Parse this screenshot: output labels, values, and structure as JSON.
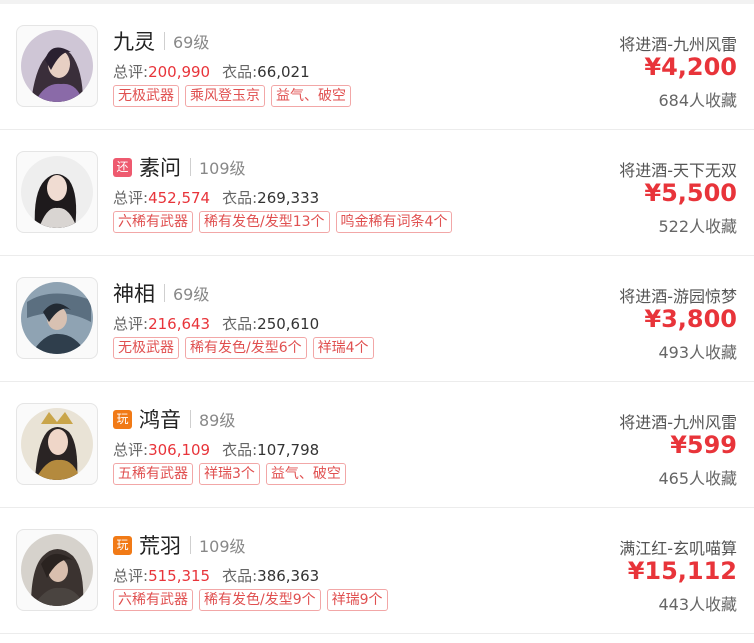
{
  "listings": [
    {
      "tag": "",
      "name": "九灵",
      "level": "69级",
      "score_label": "总评:",
      "score": "200,990",
      "outfit_label": "衣品:",
      "outfit": "66,021",
      "chips": [
        "无极武器",
        "乘风登玉京",
        "益气、破空"
      ],
      "server": "将进酒-九州风雷",
      "price": "¥4,200",
      "favorites": "684人收藏"
    },
    {
      "tag": "还",
      "name": "素问",
      "level": "109级",
      "score_label": "总评:",
      "score": "452,574",
      "outfit_label": "衣品:",
      "outfit": "269,333",
      "chips": [
        "六稀有武器",
        "稀有发色/发型13个",
        "鸣金稀有词条4个"
      ],
      "server": "将进酒-天下无双",
      "price": "¥5,500",
      "favorites": "522人收藏"
    },
    {
      "tag": "",
      "name": "神相",
      "level": "69级",
      "score_label": "总评:",
      "score": "216,643",
      "outfit_label": "衣品:",
      "outfit": "250,610",
      "chips": [
        "无极武器",
        "稀有发色/发型6个",
        "祥瑞4个"
      ],
      "server": "将进酒-游园惊梦",
      "price": "¥3,800",
      "favorites": "493人收藏"
    },
    {
      "tag": "玩",
      "name": "鸿音",
      "level": "89级",
      "score_label": "总评:",
      "score": "306,109",
      "outfit_label": "衣品:",
      "outfit": "107,798",
      "chips": [
        "五稀有武器",
        "祥瑞3个",
        "益气、破空"
      ],
      "server": "将进酒-九州风雷",
      "price": "¥599",
      "favorites": "465人收藏"
    },
    {
      "tag": "玩",
      "name": "荒羽",
      "level": "109级",
      "score_label": "总评:",
      "score": "515,315",
      "outfit_label": "衣品:",
      "outfit": "386,363",
      "chips": [
        "六稀有武器",
        "稀有发色/发型9个",
        "祥瑞9个"
      ],
      "server": "满江红-玄叽喵算",
      "price": "¥15,112",
      "favorites": "443人收藏"
    }
  ],
  "colors": {
    "price": "#e8343a",
    "score": "#e8343a",
    "chip_border": "#f2a7a7",
    "tag_huan": "#ee5a6f",
    "tag_wan": "#f17a16"
  },
  "icons": [
    "character-portrait-icon"
  ]
}
